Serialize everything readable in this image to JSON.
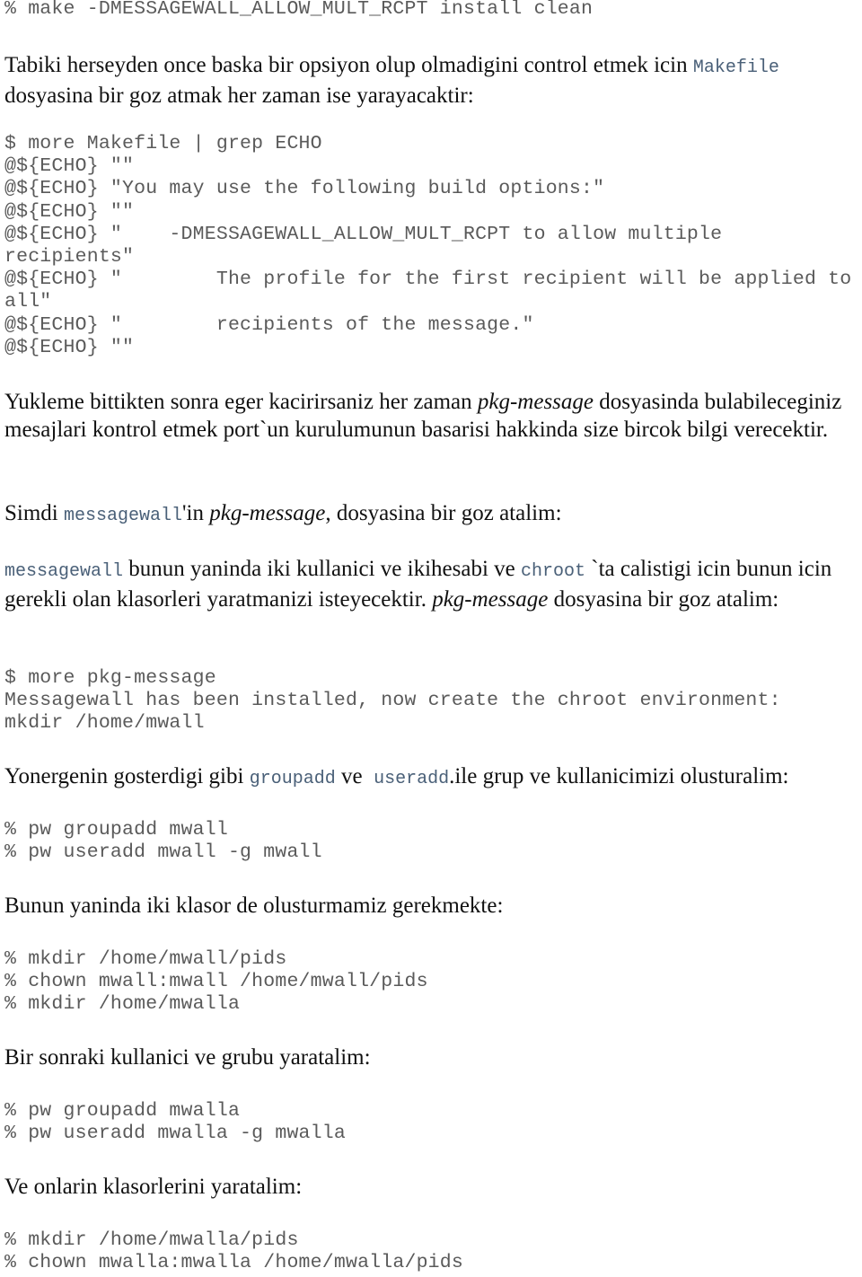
{
  "blocks": {
    "cmd_make": "% make -DMESSAGEWALL_ALLOW_MULT_RCPT install clean",
    "para1": {
      "text_a": "Tabiki herseyden once baska bir opsiyon olup olmadigini control etmek icin ",
      "code_a": "Makefile",
      "text_b": " dosyasina bir goz atmak her zaman ise yarayacaktir:"
    },
    "code_makefile": [
      "$ more Makefile | grep ECHO",
      "@${ECHO} \"\"",
      "@${ECHO} \"You may use the following build options:\"",
      "@${ECHO} \"\"",
      "@${ECHO} \"    -DMESSAGEWALL_ALLOW_MULT_RCPT to allow multiple",
      "recipients\"",
      "@${ECHO} \"        The profile for the first recipient will be applied to",
      "all\"",
      "@${ECHO} \"        recipients of the message.\"",
      "@${ECHO} \"\""
    ],
    "para2": {
      "text_a": "Yukleme bittikten sonra eger kacirirsaniz her zaman ",
      "em_a": "pkg-message",
      "text_b": " dosyasinda bulabileceginiz mesajlari kontrol etmek port`un kurulumunun basarisi hakkinda size bircok bilgi verecektir."
    },
    "para3": {
      "text_a": "Simdi ",
      "code_a": "messagewall",
      "text_b": "'in ",
      "em_a": "pkg-message",
      "text_c": ", dosyasina bir goz atalim:"
    },
    "para4": {
      "code_a": "messagewall",
      "text_a": " bunun yaninda iki kullanici ve ikihesabi ve ",
      "code_b": "chroot",
      "text_b": " `ta calistigi icin bunun icin gerekli olan klasorleri yaratmanizi isteyecektir. ",
      "em_a": "pkg-message",
      "text_c": " dosyasina bir goz atalim:"
    },
    "code_pkgmsg": [
      "$ more pkg-message",
      "Messagewall has been installed, now create the chroot environment:",
      "mkdir /home/mwall"
    ],
    "para5": {
      "text_a": "Yonergenin gosterdigi gibi ",
      "code_a": "groupadd",
      "text_b": " ve  ",
      "code_b": "useradd",
      "text_c": ".ile grup ve kullanicimizi olusturalim:"
    },
    "code_pw1": [
      "% pw groupadd mwall",
      "% pw useradd mwall -g mwall"
    ],
    "para6": "Bunun yaninda iki klasor de olusturmamiz gerekmekte:",
    "code_mkdir1": [
      "% mkdir /home/mwall/pids",
      "% chown mwall:mwall /home/mwall/pids",
      "% mkdir /home/mwalla"
    ],
    "para7": "Bir sonraki kullanici ve grubu yaratalim:",
    "code_pw2": [
      "% pw groupadd mwalla",
      "% pw useradd mwalla -g mwalla"
    ],
    "para8": "Ve onlarin klasorlerini yaratalim:",
    "code_mkdir2": [
      "% mkdir /home/mwalla/pids",
      "% chown mwalla:mwalla /home/mwalla/pids"
    ]
  }
}
